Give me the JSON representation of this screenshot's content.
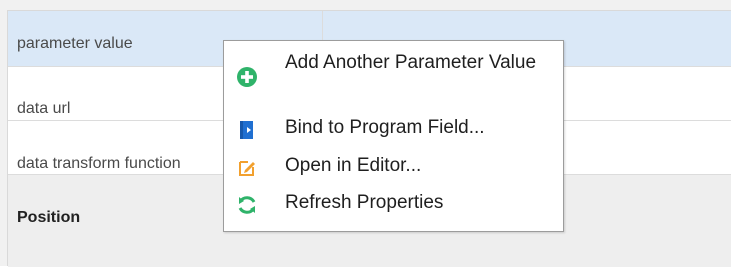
{
  "properties": {
    "rows": [
      {
        "label": "parameter value"
      },
      {
        "label": "data url"
      },
      {
        "label": "data transform function"
      },
      {
        "label": "Position"
      }
    ]
  },
  "context_menu": {
    "items": [
      {
        "label": "Add Another Parameter Value",
        "icon": "add-circle-icon"
      },
      {
        "label": "Bind to Program Field...",
        "icon": "bind-field-icon"
      },
      {
        "label": "Open in Editor...",
        "icon": "edit-icon"
      },
      {
        "label": "Refresh Properties",
        "icon": "refresh-icon"
      }
    ]
  },
  "colors": {
    "selected_row": "#dae8f7",
    "add_icon": "#2fb36a",
    "bind_icon": "#1f6fd1",
    "edit_icon": "#f2a02e",
    "refresh_icon": "#2fb36a"
  }
}
